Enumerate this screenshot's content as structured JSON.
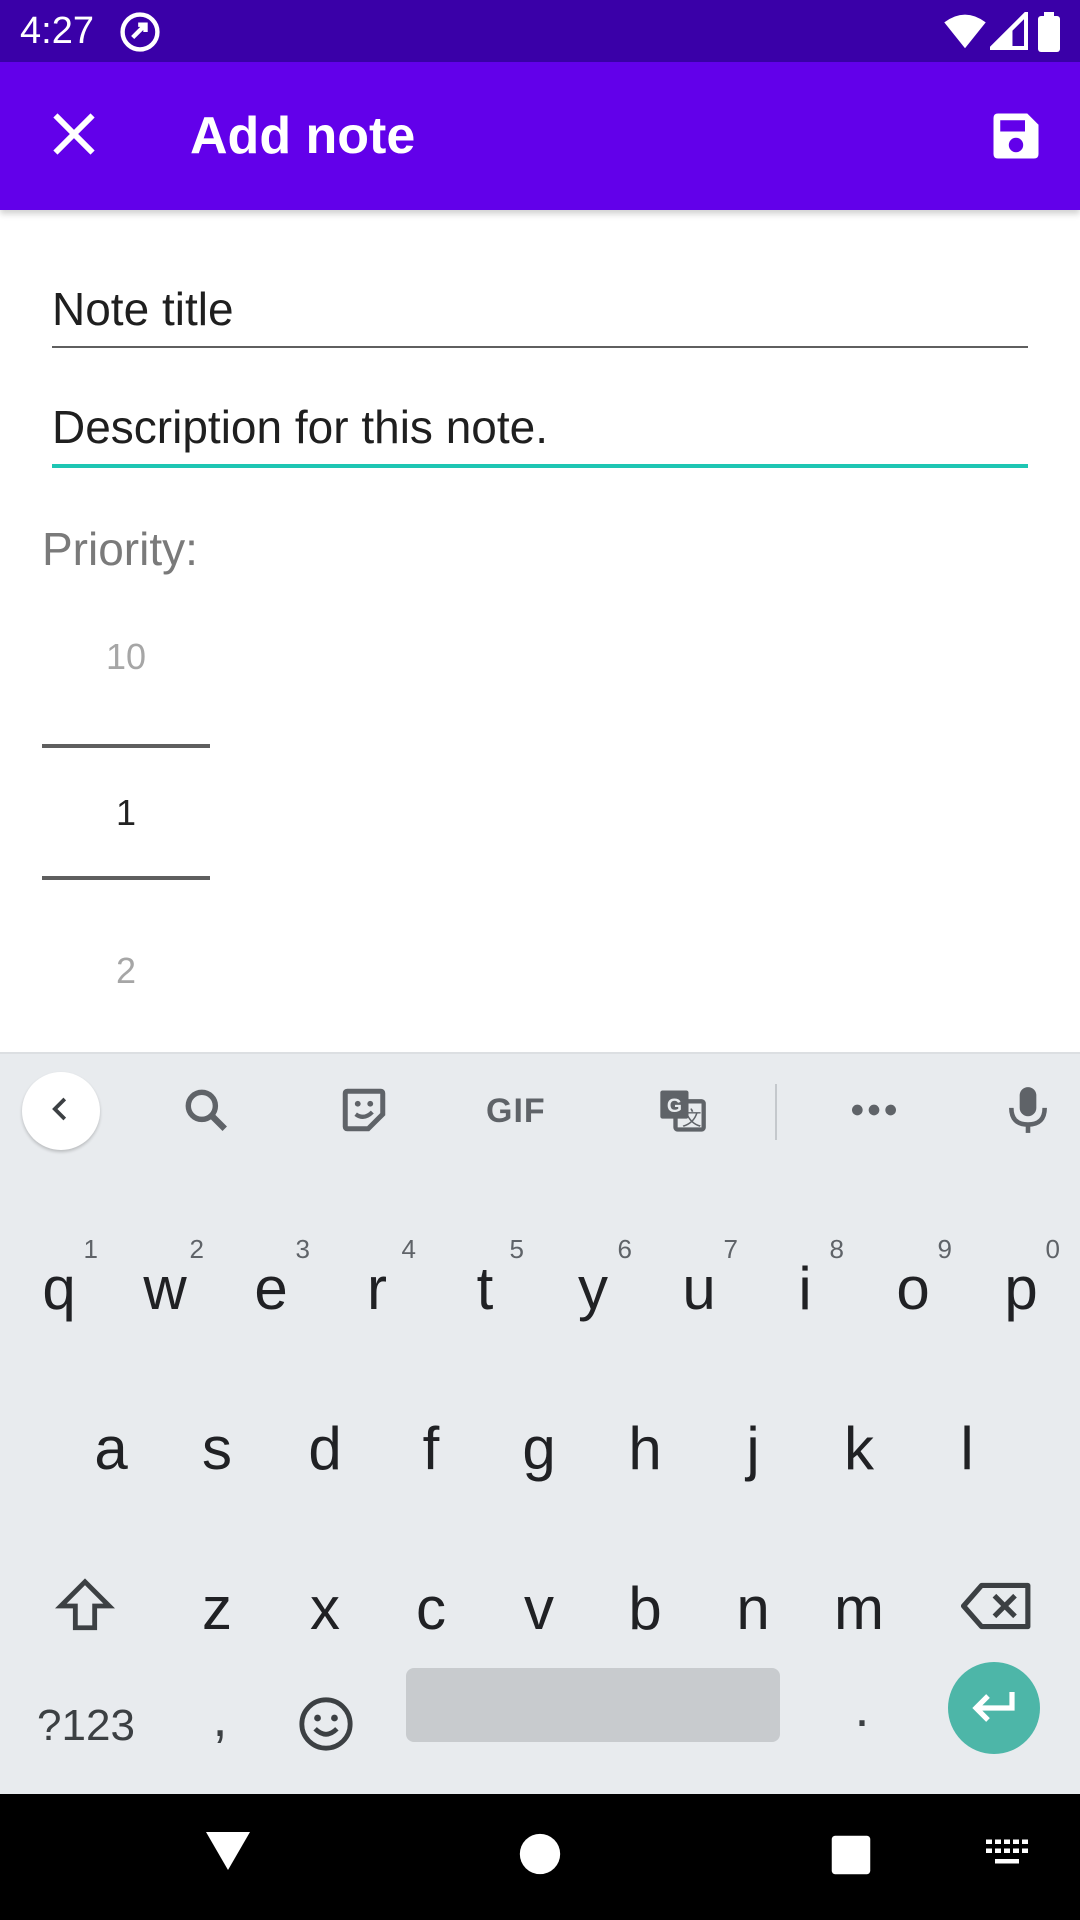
{
  "status_bar": {
    "time": "4:27",
    "icons": [
      "at-sign-icon",
      "wifi-icon",
      "signal-icon",
      "battery-icon"
    ]
  },
  "app_bar": {
    "title": "Add note",
    "close_icon": "close-icon",
    "save_icon": "save-icon",
    "color": "#6200ea"
  },
  "form": {
    "title_value": "Note title",
    "description_value": "Description for this note.",
    "priority_label": "Priority:",
    "accent_color": "#1ec6b3"
  },
  "priority_picker": {
    "previous": "10",
    "selected": "1",
    "next": "2"
  },
  "keyboard": {
    "toolbar": {
      "gif_label": "GIF",
      "icons": [
        "chevron-left-icon",
        "search-icon",
        "sticker-icon",
        "gif-icon",
        "translate-icon",
        "more-icon",
        "microphone-icon"
      ]
    },
    "row1": [
      {
        "key": "q",
        "hint": "1"
      },
      {
        "key": "w",
        "hint": "2"
      },
      {
        "key": "e",
        "hint": "3"
      },
      {
        "key": "r",
        "hint": "4"
      },
      {
        "key": "t",
        "hint": "5"
      },
      {
        "key": "y",
        "hint": "6"
      },
      {
        "key": "u",
        "hint": "7"
      },
      {
        "key": "i",
        "hint": "8"
      },
      {
        "key": "o",
        "hint": "9"
      },
      {
        "key": "p",
        "hint": "0"
      }
    ],
    "row2": [
      "a",
      "s",
      "d",
      "f",
      "g",
      "h",
      "j",
      "k",
      "l"
    ],
    "row3": [
      "z",
      "x",
      "c",
      "v",
      "b",
      "n",
      "m"
    ],
    "symbols_label": "?123",
    "comma_label": ",",
    "period_label": "."
  },
  "nav_bar": {
    "icons": [
      "back-icon",
      "home-icon",
      "recents-icon",
      "keyboard-switch-icon"
    ]
  }
}
